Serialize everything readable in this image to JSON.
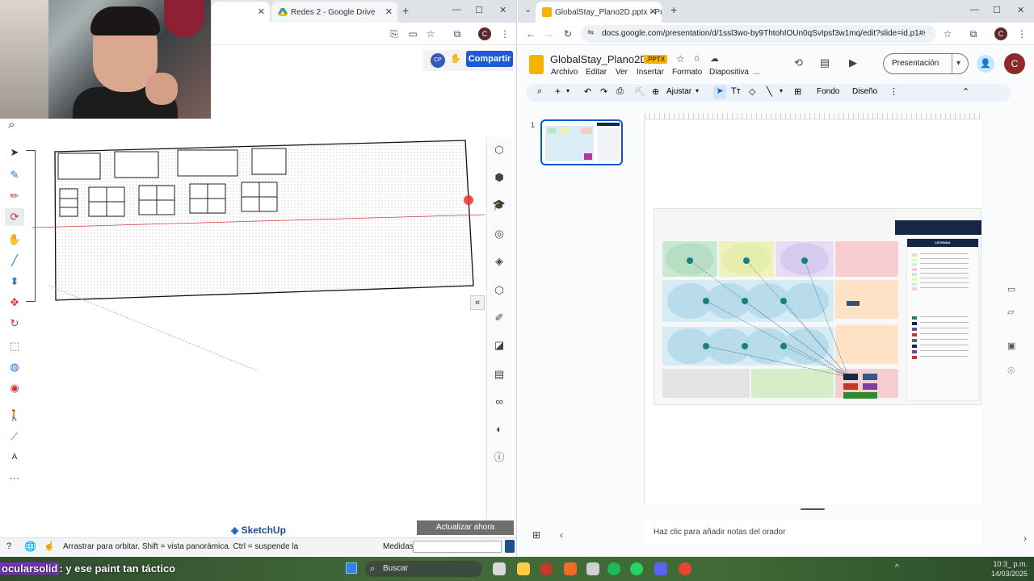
{
  "left_browser": {
    "tabs": [
      {
        "label": ""
      },
      {
        "label": "Redes 2 - Google Drive"
      }
    ],
    "profile_initial": "C"
  },
  "sketchup": {
    "share_button": "Compartir",
    "avatar_initials": "CP",
    "logo": "SketchUp",
    "update_button": "Actualizar ahora",
    "status_text": "Arrastrar para orbitar. Shift = vista panorámica. Ctrl = suspende la",
    "measures_label": "Medidas",
    "measures_value": "",
    "collapse_icon": "«"
  },
  "right_browser": {
    "tab_title": "GlobalStay_Plano2D.pptx - Pre",
    "url": "docs.google.com/presentation/d/1ssl3wo-by9ThtohIOUn0qSvIpsf3w1mq/edit?slide=id.p1#slide=i...",
    "profile_initial": "C"
  },
  "slides": {
    "doc_title": "GlobalStay_Plano2D",
    "badge": ".PPTX",
    "menus": [
      "Archivo",
      "Editar",
      "Ver",
      "Insertar",
      "Formato",
      "Diapositiva",
      "..."
    ],
    "present_button": "Presentación",
    "toolbar": {
      "zoom": "Ajustar",
      "background": "Fondo",
      "design": "Diseño"
    },
    "slide_number": "1",
    "notes_placeholder": "Haz clic para añadir notas del orador",
    "legend_title": "LEYENDA"
  },
  "taskbar": {
    "search_placeholder": "Buscar",
    "clock_time": "10:3_ p.m.",
    "clock_date": "14/03/2025"
  },
  "overlay": {
    "caption_user": "ocularsolid",
    "caption_text": ": y ese paint tan táctico"
  },
  "colors": {
    "sketchup_blue": "#1d5bd6",
    "slides_yellow": "#f4b400",
    "taskbar_green": "#3f6a35"
  }
}
